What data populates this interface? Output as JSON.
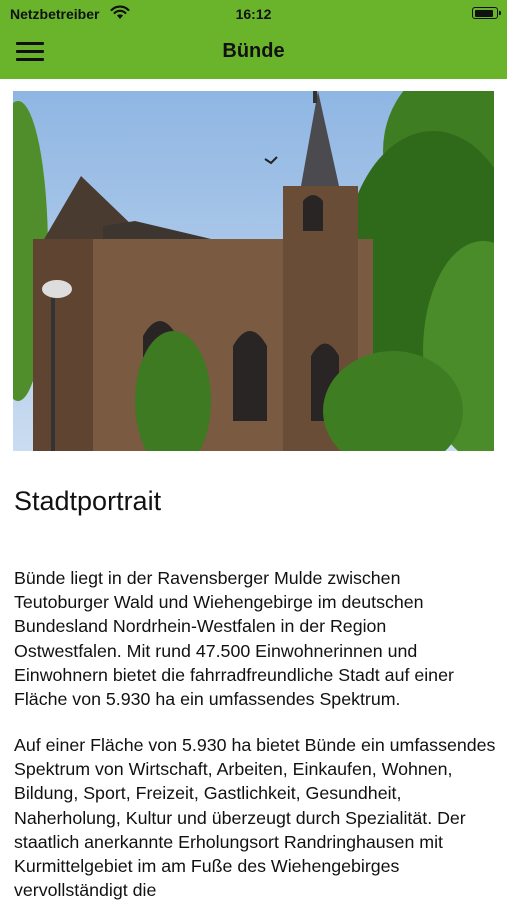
{
  "status_bar": {
    "carrier": "Netzbetreiber",
    "time": "16:12",
    "wifi_icon": "wifi-icon",
    "battery_icon": "battery-icon",
    "battery_level": 0.9
  },
  "nav_bar": {
    "title": "Bünde",
    "menu_icon": "hamburger-menu-icon",
    "color": "#6ab42b"
  },
  "hero_image": {
    "alt": "Kirche in Bünde"
  },
  "content": {
    "title": "Stadtportrait",
    "paragraphs": [
      "Bünde liegt in der Ravensberger Mulde zwischen Teutoburger Wald und Wiehengebirge im deutschen Bundesland Nordrhein-Westfalen in der Region Ostwestfalen. Mit rund 47.500 Einwohnerinnen und Einwohnern bietet die fahrradfreundliche Stadt auf einer Fläche von 5.930 ha ein umfassendes Spektrum.",
      "Auf einer Fläche von 5.930 ha bietet Bünde ein umfassendes Spektrum von Wirtschaft, Arbeiten, Einkaufen, Wohnen, Bildung, Sport, Freizeit, Gastlichkeit, Gesundheit, Naherholung, Kultur und überzeugt durch Spezialität. Der staatlich anerkannte Erholungsort Randringhausen mit Kurmittelgebiet im am Fuße des Wiehengebirges vervollständigt die"
    ]
  }
}
